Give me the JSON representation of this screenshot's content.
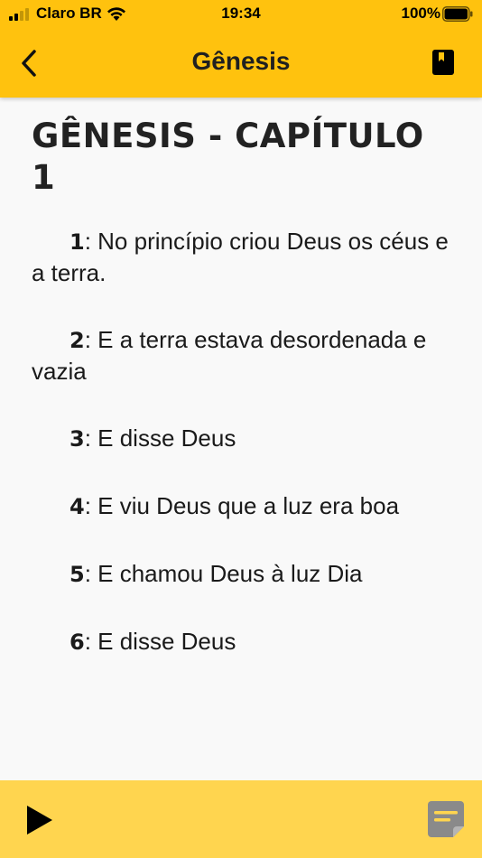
{
  "status_bar": {
    "carrier": "Claro BR",
    "time": "19:34",
    "battery": "100%"
  },
  "nav": {
    "title": "Gênesis",
    "back_icon": "chevron-left-icon",
    "book_icon": "book-icon"
  },
  "chapter": {
    "title": "GÊNESIS - CAPÍTULO 1",
    "verses": [
      {
        "num": "1",
        "text": ": No princípio criou Deus os céus e a terra."
      },
      {
        "num": "2",
        "text": ": E a terra estava desordenada e vazia"
      },
      {
        "num": "3",
        "text": ": E disse Deus"
      },
      {
        "num": "4",
        "text": ": E viu Deus que a luz era boa"
      },
      {
        "num": "5",
        "text": ": E chamou Deus à luz Dia"
      },
      {
        "num": "6",
        "text": ": E disse Deus"
      }
    ]
  },
  "bottom_bar": {
    "play_icon": "play-icon",
    "notes_icon": "note-icon"
  },
  "colors": {
    "header": "#ffc20e",
    "bottom_bar": "#ffd54f",
    "background": "#f9f9f9"
  }
}
